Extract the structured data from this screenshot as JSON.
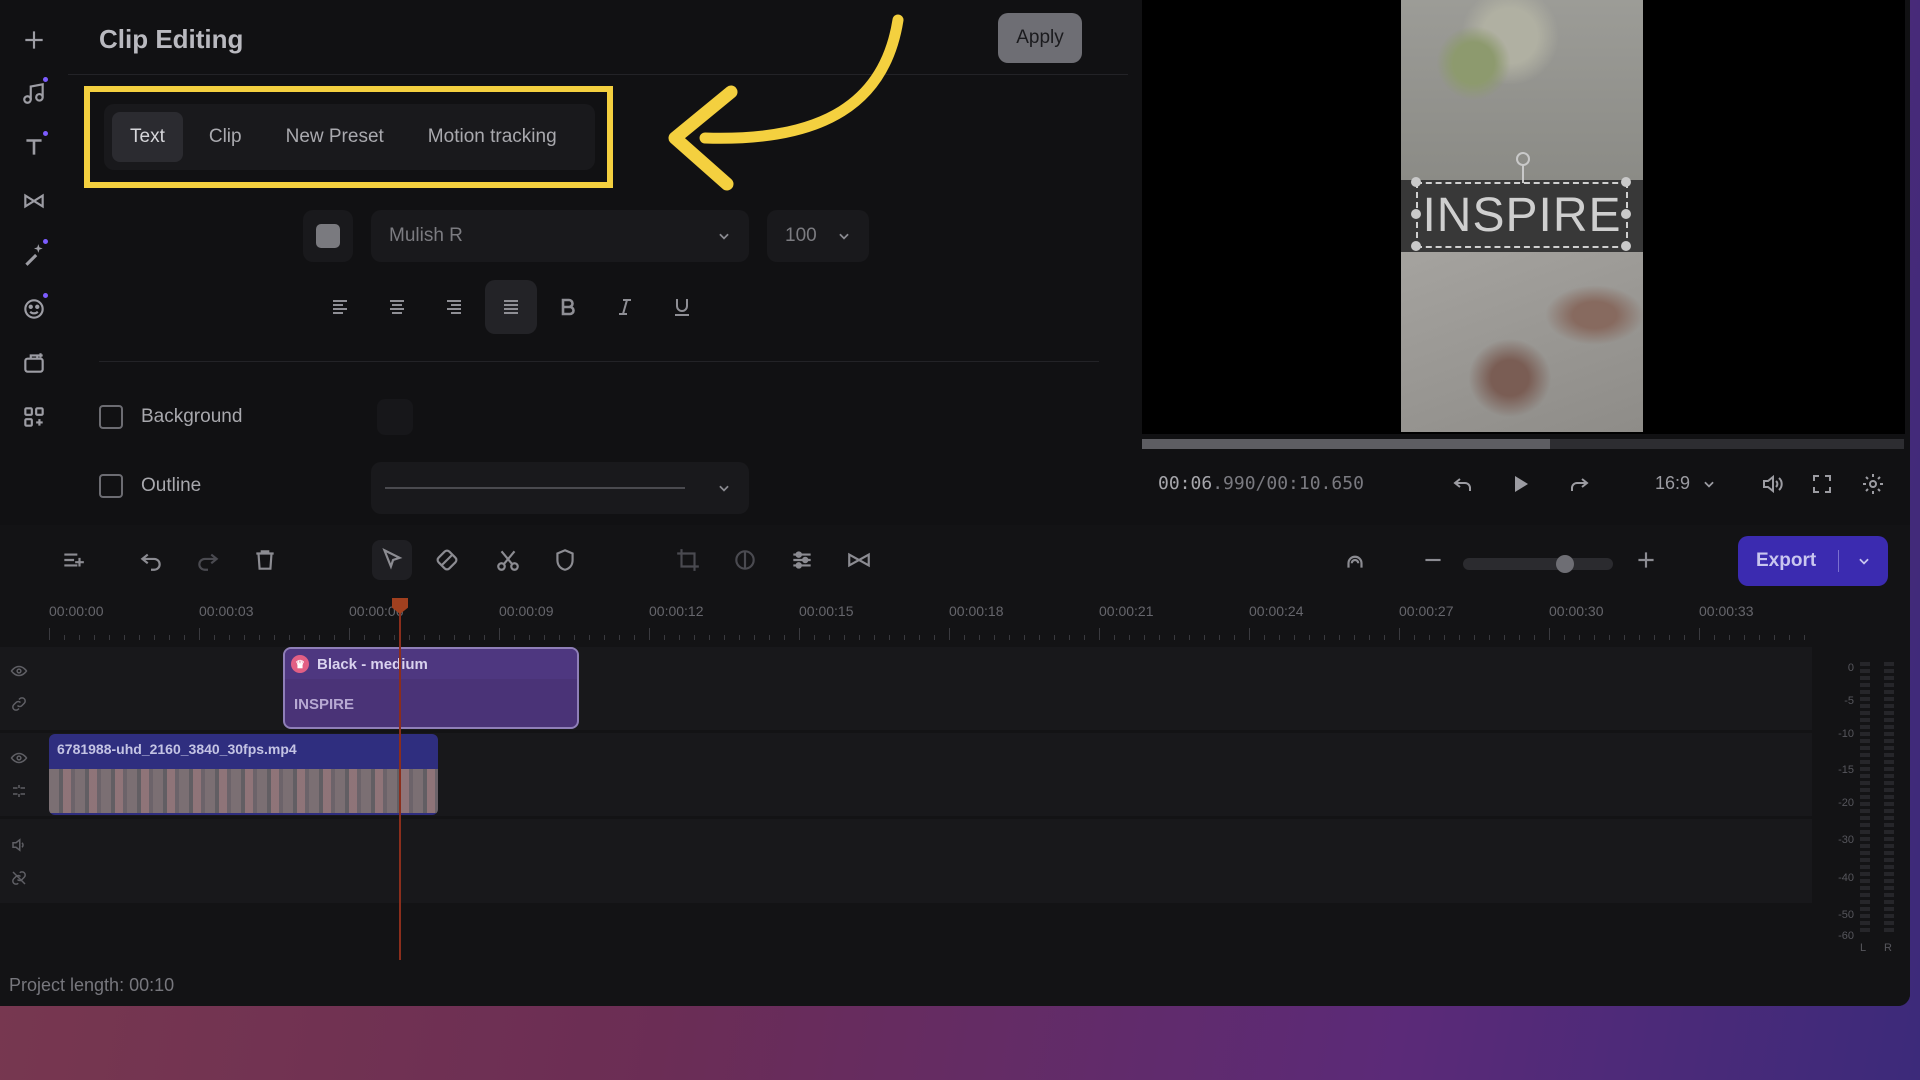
{
  "panel": {
    "title": "Clip Editing",
    "apply_label": "Apply",
    "tabs": [
      "Text",
      "Clip",
      "New Preset",
      "Motion tracking"
    ],
    "font": "Mulish R",
    "font_size": "100",
    "background_label": "Background",
    "outline_label": "Outline"
  },
  "rail": {
    "icons": [
      "plus-icon",
      "music-icon",
      "text-icon",
      "transition-icon",
      "effects-icon",
      "sticker-icon",
      "templates-icon",
      "apps-icon"
    ]
  },
  "preview": {
    "overlay_text": "INSPIRE",
    "timecode_current": "00:06",
    "timecode_rest": ".990/00:10.650",
    "aspect_ratio": "16:9",
    "progress": 0.536
  },
  "timeline": {
    "ruler_labels": [
      "00:00:00",
      "00:00:03",
      "00:00:06",
      "00:00:09",
      "00:00:12",
      "00:00:15",
      "00:00:18",
      "00:00:21",
      "00:00:24",
      "00:00:27",
      "00:00:30",
      "00:00:33"
    ],
    "text_clip": {
      "title": "Black - medium",
      "text": "INSPIRE"
    },
    "video_clip": {
      "name": "6781988-uhd_2160_3840_30fps.mp4"
    },
    "zoom_level": 0.68,
    "export_label": "Export",
    "meter_labels": [
      "0",
      "-5",
      "-10",
      "-15",
      "-20",
      "-30",
      "-40",
      "-50",
      "-60"
    ],
    "meter_channels": [
      "L",
      "R"
    ],
    "project_length": "Project length: 00:10"
  },
  "colors": {
    "highlight": "#f4d03f",
    "export": "#3b2bb0",
    "text_clip": "#4a3377",
    "video_clip": "#2f2e7f"
  }
}
